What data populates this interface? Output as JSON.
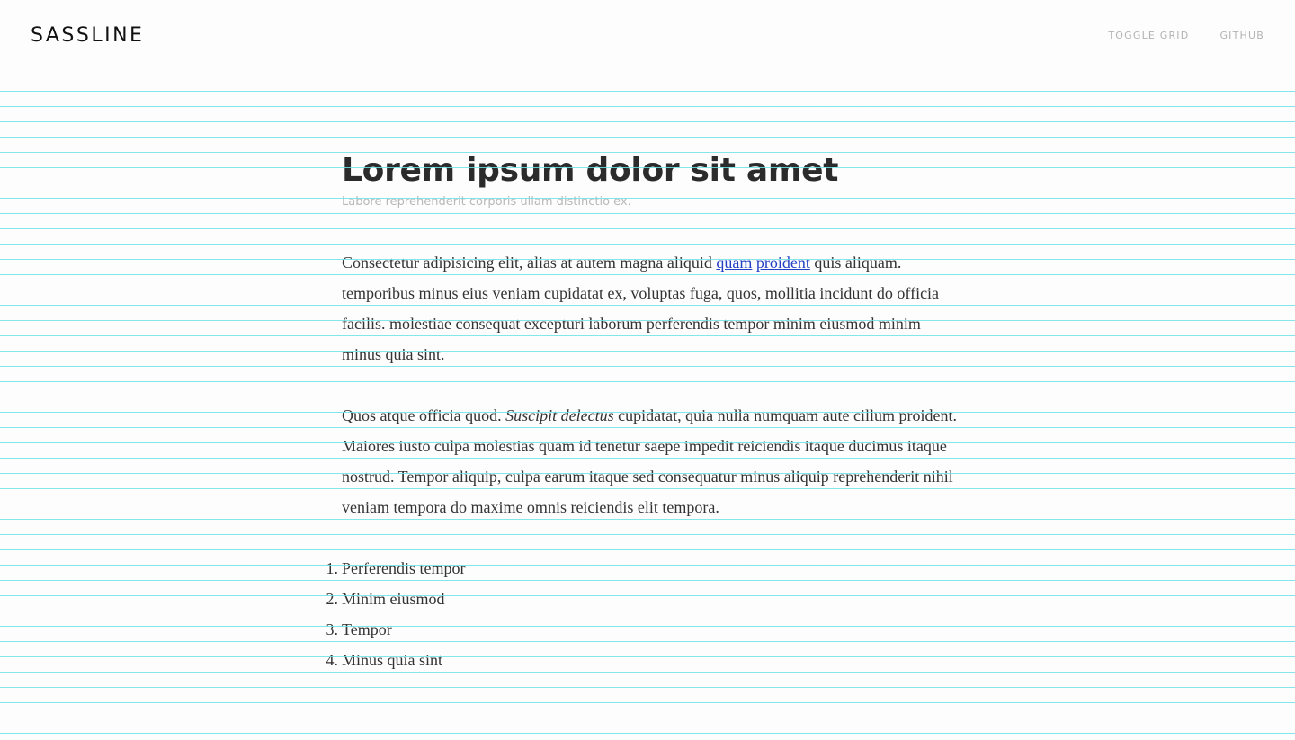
{
  "header": {
    "logo": "SASSLINE",
    "nav": [
      "TOGGLE GRID",
      "GITHUB"
    ]
  },
  "article": {
    "title": "Lorem ipsum dolor sit amet",
    "subtitle": "Labore reprehenderit corporis ullam distinctio ex.",
    "para1": {
      "before_link": "Consectetur adipisicing elit, alias at autem magna aliquid ",
      "link_words": [
        "quam",
        "proident"
      ],
      "after_link": " quis aliquam. temporibus minus eius veniam cupidatat ex, voluptas fuga, quos, mollitia incidunt do officia facilis. molestiae consequat excepturi laborum perferendis tempor minim eiusmod minim minus quia sint."
    },
    "para2": {
      "before_em": "Quos atque officia quod. ",
      "em": "Suscipit delectus",
      "after_em": " cupidatat, quia nulla numquam aute cillum proident. Maiores iusto culpa molestias quam id tenetur saepe impedit reiciendis itaque ducimus itaque nostrud. Tempor aliquip, culpa earum itaque sed consequatur minus aliquip reprehenderit nihil veniam tempora do maxime omnis reiciendis elit tempora."
    },
    "list": [
      {
        "num": "1.",
        "text": "Perferendis tempor"
      },
      {
        "num": "2.",
        "text": "Minim eiusmod"
      },
      {
        "num": "3.",
        "text": "Tempor"
      },
      {
        "num": "4.",
        "text": "Minus quia sint"
      }
    ]
  },
  "colors": {
    "baseline_grid": "#6ee2e6",
    "link": "#2240c4",
    "text": "#333333",
    "muted": "#b3b3b3"
  }
}
